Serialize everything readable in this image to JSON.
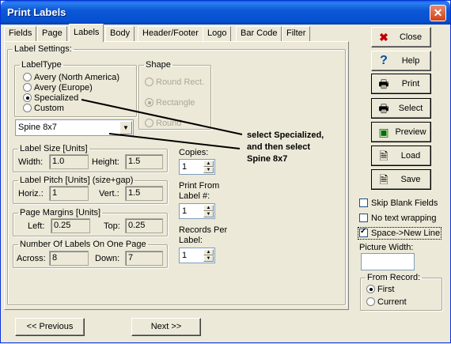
{
  "window": {
    "title": "Print Labels",
    "close_glyph": "✕"
  },
  "tabs": [
    {
      "label": "Fields"
    },
    {
      "label": "Page"
    },
    {
      "label": "Labels",
      "active": true
    },
    {
      "label": "Body"
    },
    {
      "label": "Header/Footer"
    },
    {
      "label": "Logo"
    },
    {
      "label": "Bar Code"
    },
    {
      "label": "Filter"
    }
  ],
  "label_settings": {
    "title": "Label Settings:",
    "label_type": {
      "title": "LabelType",
      "options": [
        "Avery (North America)",
        "Avery (Europe)",
        "Specialized",
        "Custom"
      ],
      "selected": "Specialized"
    },
    "shape": {
      "title": "Shape",
      "options": [
        "Round Rect.",
        "Rectangle",
        "Round"
      ],
      "selected": "Rectangle"
    },
    "label_combo": {
      "value": "Spine 8x7"
    },
    "label_size": {
      "title": "Label Size [Units]",
      "width_label": "Width:",
      "width": "1.0",
      "height_label": "Height:",
      "height": "1.5"
    },
    "label_pitch": {
      "title": "Label Pitch [Units] (size+gap)",
      "horiz_label": "Horiz.:",
      "horiz": "1",
      "vert_label": "Vert.:",
      "vert": "1.5"
    },
    "page_margins": {
      "title": "Page Margins [Units]",
      "left_label": "Left:",
      "left": "0.25",
      "top_label": "Top:",
      "top": "0.25"
    },
    "labels_on_page": {
      "title": "Number Of Labels On One Page",
      "across_label": "Across:",
      "across": "8",
      "down_label": "Down:",
      "down": "7"
    },
    "copies": {
      "label": "Copies:",
      "value": "1"
    },
    "print_from": {
      "label_line1": "Print From",
      "label_line2": "Label #:",
      "value": "1"
    },
    "records_per_label": {
      "label_line1": "Records Per",
      "label_line2": "Label:",
      "value": "1"
    }
  },
  "annotation": {
    "line1": "select Specialized,",
    "line2": "and  then select",
    "line3": "Spine 8x7"
  },
  "side_buttons": [
    {
      "label": "Close",
      "icon": "close-x-icon",
      "glyph": "✖",
      "color": "#c00000"
    },
    {
      "label": "Help",
      "icon": "help-question-icon",
      "glyph": "?",
      "color": "#0050a0"
    },
    {
      "label": "Print",
      "icon": "printer-icon",
      "glyph": "🖶",
      "color": "#000000"
    },
    {
      "label": "Select",
      "icon": "printer-select-icon",
      "glyph": "🖶",
      "color": "#000000"
    },
    {
      "label": "Preview",
      "icon": "monitor-preview-icon",
      "glyph": "▣",
      "color": "#007000"
    },
    {
      "label": "Load",
      "icon": "document-load-icon",
      "glyph": "🗎",
      "color": "#000000"
    },
    {
      "label": "Save",
      "icon": "document-save-icon",
      "glyph": "🗎",
      "color": "#000000"
    }
  ],
  "options": {
    "skip_blank_fields": {
      "label": "Skip Blank Fields",
      "checked": false
    },
    "no_text_wrapping": {
      "label": "No text wrapping",
      "checked": false
    },
    "space_new_line": {
      "label": "Space->New Line",
      "checked": true
    },
    "picture_width": {
      "label": "Picture Width:",
      "value": ""
    }
  },
  "from_record": {
    "title": "From Record:",
    "options": [
      "First",
      "Current"
    ],
    "selected": "First"
  },
  "nav": {
    "previous": "<< Previous",
    "next": "Next >>"
  }
}
